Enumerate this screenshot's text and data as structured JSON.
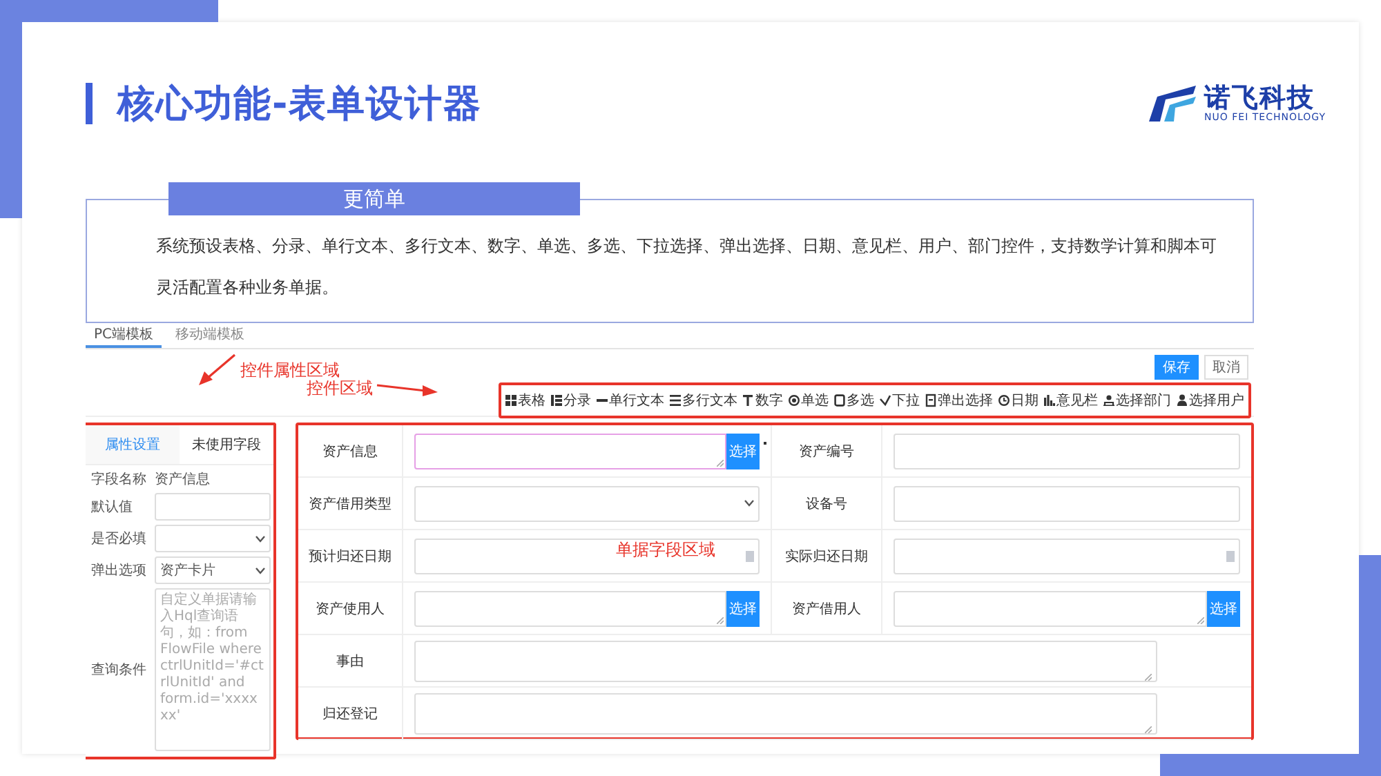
{
  "title": "核心功能-表单设计器",
  "logo": {
    "name": "诺飞科技",
    "tagline": "NUO FEI TECHNOLOGY"
  },
  "intro": {
    "heading": "更简单",
    "text": "系统预设表格、分录、单行文本、多行文本、数字、单选、多选、下拉选择、弹出选择、日期、意见栏、用户、部门控件，支持数学计算和脚本可灵活配置各种业务单据。"
  },
  "designer": {
    "tabs": [
      {
        "label": "PC端模板",
        "selected": true
      },
      {
        "label": "移动端模板",
        "selected": false
      }
    ],
    "buttons": [
      {
        "label": "保存",
        "kind": "primary"
      },
      {
        "label": "取消",
        "kind": "default"
      }
    ],
    "annotations": [
      {
        "text": "控件属性区域",
        "kind": "arrow-down-left"
      },
      {
        "text": "控件区域",
        "kind": "arrow-right"
      },
      {
        "text": "单据字段区域",
        "kind": "none"
      }
    ],
    "toolbar": [
      {
        "label": "表格",
        "kind": "grid"
      },
      {
        "label": "分录",
        "kind": "list"
      },
      {
        "label": "单行文本",
        "kind": "line"
      },
      {
        "label": "多行文本",
        "kind": "lines"
      },
      {
        "label": "数字",
        "kind": "number"
      },
      {
        "label": "单选",
        "kind": "radio"
      },
      {
        "label": "多选",
        "kind": "checkbox"
      },
      {
        "label": "下拉",
        "kind": "dropdown"
      },
      {
        "label": "弹出选择",
        "kind": "popup"
      },
      {
        "label": "日期",
        "kind": "date"
      },
      {
        "label": "意见栏",
        "kind": "opinion"
      },
      {
        "label": "选择部门",
        "kind": "department"
      },
      {
        "label": "选择用户",
        "kind": "user"
      }
    ],
    "properties": {
      "tabs": [
        {
          "label": "属性设置",
          "selected": true
        },
        {
          "label": "未使用字段",
          "selected": false
        }
      ],
      "rows": [
        {
          "label": "字段名称",
          "kind": "text",
          "value": "资产信息"
        },
        {
          "label": "默认值",
          "kind": "input"
        },
        {
          "label": "是否必填",
          "kind": "select"
        },
        {
          "label": "弹出选项",
          "kind": "select",
          "value": "资产卡片"
        },
        {
          "label": "查询条件",
          "kind": "textarea",
          "placeholder": "自定义单据请输入Hql查询语句，如：from FlowFile where ctrlUnitId='#ctrlUnitId' and form.id='xxxxxx'"
        }
      ]
    },
    "form": {
      "rows": [
        [
          {
            "label": "资产信息",
            "kind": "picker",
            "button": "选择",
            "focused": true
          },
          {
            "label": "资产编号",
            "kind": "input",
            "focused": false
          }
        ],
        [
          {
            "label": "资产借用类型",
            "kind": "select",
            "focused": false
          },
          {
            "label": "设备号",
            "kind": "input",
            "focused": false
          }
        ],
        [
          {
            "label": "预计归还日期",
            "kind": "date",
            "focused": false
          },
          {
            "label": "实际归还日期",
            "kind": "date",
            "focused": false
          }
        ],
        [
          {
            "label": "资产使用人",
            "kind": "picker",
            "button": "选择",
            "focused": false
          },
          {
            "label": "资产借用人",
            "kind": "picker",
            "button": "选择",
            "focused": false
          }
        ],
        [
          {
            "label": "事由",
            "kind": "textarea",
            "focused": false
          }
        ],
        [
          {
            "label": "归还登记",
            "kind": "textarea",
            "focused": false
          }
        ]
      ]
    }
  }
}
